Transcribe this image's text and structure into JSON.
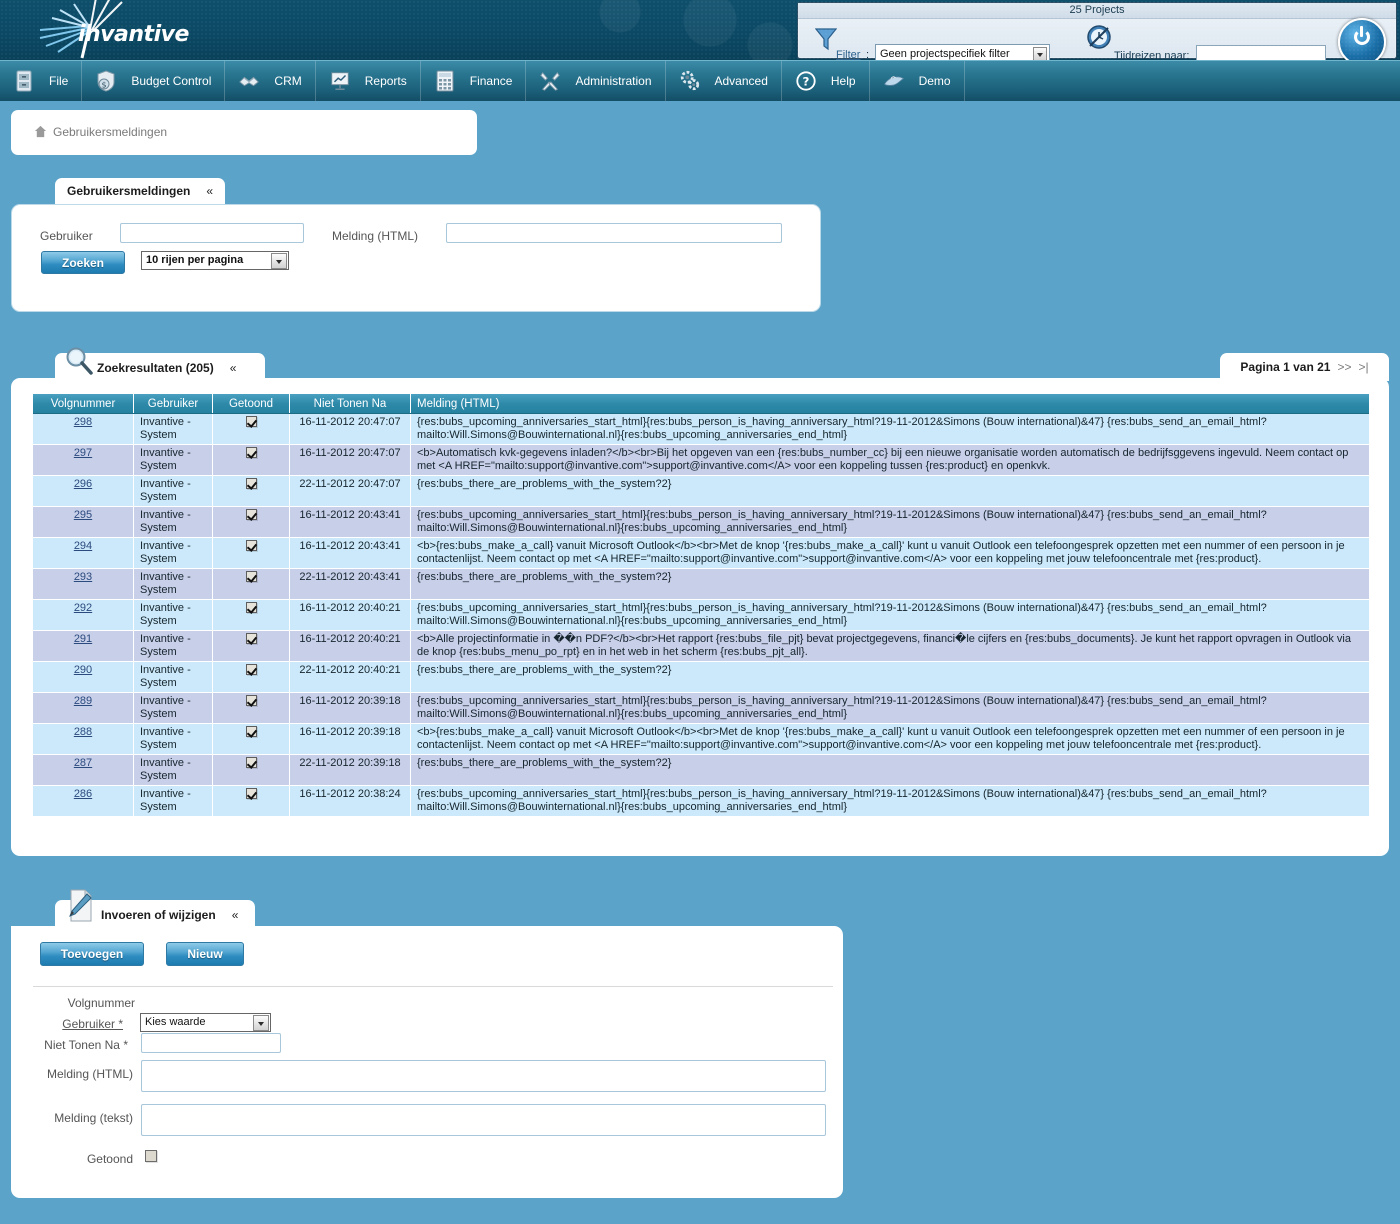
{
  "banner": {
    "brand": "invantive"
  },
  "toppanel": {
    "title": "25 Projects",
    "filter_label": "Filter",
    "filter_colon": ":",
    "filter_value": "Geen projectspecifiek filter",
    "timetravel_label": "Tijdreizen naar:",
    "timetravel_value": ""
  },
  "menu": [
    {
      "label": "File",
      "icon": "cabinet-icon"
    },
    {
      "label": "Budget Control",
      "icon": "money-shield-icon"
    },
    {
      "label": "CRM",
      "icon": "handshake-icon"
    },
    {
      "label": "Reports",
      "icon": "presentation-chart-icon"
    },
    {
      "label": "Finance",
      "icon": "calculator-icon"
    },
    {
      "label": "Administration",
      "icon": "tools-icon"
    },
    {
      "label": "Advanced",
      "icon": "gears-icon"
    },
    {
      "label": "Help",
      "icon": "question-mark-icon"
    },
    {
      "label": "Demo",
      "icon": "dolphin-icon"
    }
  ],
  "breadcrumb": {
    "home_icon": "home-icon",
    "label": "Gebruikersmeldingen"
  },
  "search": {
    "tab_label": "Gebruikersmeldingen",
    "collapse_glyph": "«",
    "user_label": "Gebruiker",
    "user_value": "",
    "message_label": "Melding (HTML)",
    "message_value": "",
    "search_button": "Zoeken",
    "rows_per_page": "10 rijen per pagina"
  },
  "results": {
    "tab_label": "Zoekresultaten (205)",
    "collapse_glyph": "«",
    "pager_text": "Pagina 1 van 21",
    "pager_next": ">>",
    "pager_last": ">|",
    "columns": [
      "Volgnummer",
      "Gebruiker",
      "Getoond",
      "Niet Tonen Na",
      "Melding (HTML)"
    ],
    "rows": [
      {
        "num": "298",
        "user": "Invantive - System",
        "shown": true,
        "not_after": "16-11-2012 20:47:07",
        "msg": "{res:bubs_upcoming_anniversaries_start_html}{res:bubs_person_is_having_anniversary_html?19-11-2012&Simons (Bouw international)&47} {res:bubs_send_an_email_html?mailto:Will.Simons@Bouwinternational.nl}{res:bubs_upcoming_anniversaries_end_html}"
      },
      {
        "num": "297",
        "user": "Invantive - System",
        "shown": true,
        "not_after": "16-11-2012 20:47:07",
        "msg": "<b>Automatisch kvk-gegevens inladen?</b><br>Bij het opgeven van een {res:bubs_number_cc} bij een nieuwe organisatie worden automatisch de bedrijfsggevens ingevuld. Neem contact op met <A HREF=\"mailto:support@invantive.com\">support@invantive.com</A> voor een koppeling tussen {res:product} en openkvk."
      },
      {
        "num": "296",
        "user": "Invantive - System",
        "shown": true,
        "not_after": "22-11-2012 20:47:07",
        "msg": "{res:bubs_there_are_problems_with_the_system?2}"
      },
      {
        "num": "295",
        "user": "Invantive - System",
        "shown": true,
        "not_after": "16-11-2012 20:43:41",
        "msg": "{res:bubs_upcoming_anniversaries_start_html}{res:bubs_person_is_having_anniversary_html?19-11-2012&Simons (Bouw international)&47} {res:bubs_send_an_email_html?mailto:Will.Simons@Bouwinternational.nl}{res:bubs_upcoming_anniversaries_end_html}"
      },
      {
        "num": "294",
        "user": "Invantive - System",
        "shown": true,
        "not_after": "16-11-2012 20:43:41",
        "msg": "<b>{res:bubs_make_a_call} vanuit Microsoft Outlook</b><br>Met de knop '{res:bubs_make_a_call}' kunt u vanuit Outlook een telefoongesprek opzetten met een nummer of een persoon in je contactenlijst. Neem contact op met <A HREF=\"mailto:support@invantive.com\">support@invantive.com</A> voor een koppeling met jouw telefooncentrale met {res:product}."
      },
      {
        "num": "293",
        "user": "Invantive - System",
        "shown": true,
        "not_after": "22-11-2012 20:43:41",
        "msg": "{res:bubs_there_are_problems_with_the_system?2}"
      },
      {
        "num": "292",
        "user": "Invantive - System",
        "shown": true,
        "not_after": "16-11-2012 20:40:21",
        "msg": "{res:bubs_upcoming_anniversaries_start_html}{res:bubs_person_is_having_anniversary_html?19-11-2012&Simons (Bouw international)&47} {res:bubs_send_an_email_html?mailto:Will.Simons@Bouwinternational.nl}{res:bubs_upcoming_anniversaries_end_html}"
      },
      {
        "num": "291",
        "user": "Invantive - System",
        "shown": true,
        "not_after": "16-11-2012 20:40:21",
        "msg": "<b>Alle projectinformatie in ��n PDF?</b><br>Het rapport {res:bubs_file_pjt} bevat projectgegevens, financi�le cijfers en {res:bubs_documents}. Je kunt het rapport opvragen in Outlook via de knop {res:bubs_menu_po_rpt} en in het web in het scherm {res:bubs_pjt_all}."
      },
      {
        "num": "290",
        "user": "Invantive - System",
        "shown": true,
        "not_after": "22-11-2012 20:40:21",
        "msg": "{res:bubs_there_are_problems_with_the_system?2}"
      },
      {
        "num": "289",
        "user": "Invantive - System",
        "shown": true,
        "not_after": "16-11-2012 20:39:18",
        "msg": "{res:bubs_upcoming_anniversaries_start_html}{res:bubs_person_is_having_anniversary_html?19-11-2012&Simons (Bouw international)&47} {res:bubs_send_an_email_html?mailto:Will.Simons@Bouwinternational.nl}{res:bubs_upcoming_anniversaries_end_html}"
      },
      {
        "num": "288",
        "user": "Invantive - System",
        "shown": true,
        "not_after": "16-11-2012 20:39:18",
        "msg": "<b>{res:bubs_make_a_call} vanuit Microsoft Outlook</b><br>Met de knop '{res:bubs_make_a_call}' kunt u vanuit Outlook een telefoongesprek opzetten met een nummer of een persoon in je contactenlijst. Neem contact op met <A HREF=\"mailto:support@invantive.com\">support@invantive.com</A> voor een koppeling met jouw telefooncentrale met {res:product}."
      },
      {
        "num": "287",
        "user": "Invantive - System",
        "shown": true,
        "not_after": "22-11-2012 20:39:18",
        "msg": "{res:bubs_there_are_problems_with_the_system?2}"
      },
      {
        "num": "286",
        "user": "Invantive - System",
        "shown": true,
        "not_after": "16-11-2012 20:38:24",
        "msg": "{res:bubs_upcoming_anniversaries_start_html}{res:bubs_person_is_having_anniversary_html?19-11-2012&Simons (Bouw international)&47} {res:bubs_send_an_email_html?mailto:Will.Simons@Bouwinternational.nl}{res:bubs_upcoming_anniversaries_end_html}"
      }
    ]
  },
  "entry": {
    "tab_label": "Invoeren of wijzigen",
    "collapse_glyph": "«",
    "add_button": "Toevoegen",
    "new_button": "Nieuw",
    "f_volgnummer": "Volgnummer",
    "f_volgnummer_value": "",
    "f_gebruiker": "Gebruiker *",
    "f_gebruiker_value": "Kies waarde",
    "f_niet_tonen_na": "Niet Tonen Na *",
    "f_niet_tonen_na_value": "",
    "f_melding_html": "Melding (HTML)",
    "f_melding_html_value": "",
    "f_melding_tekst": "Melding (tekst)",
    "f_melding_tekst_value": "",
    "f_getoond": "Getoond",
    "f_getoond_checked": false
  },
  "colors": {
    "page_bg": "#5ba3c9",
    "banner": "#0c4a66",
    "menubar": "#2a7791",
    "grid_header": "#2f8aaa",
    "row_odd": "#cbe9fa",
    "row_even": "#c8cfe9",
    "accent_button": "#2f8cc0",
    "link": "#2b4a7e"
  }
}
